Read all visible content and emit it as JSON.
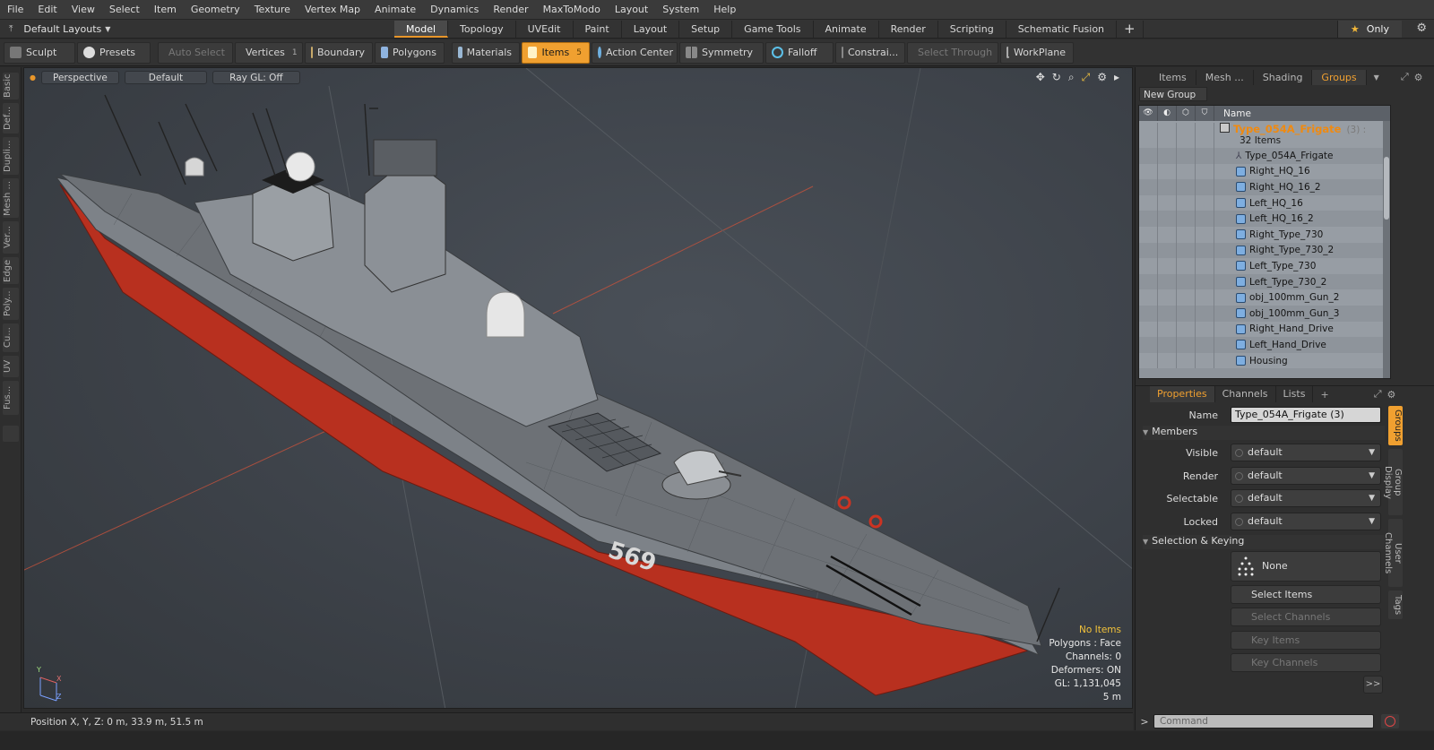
{
  "menu": [
    "File",
    "Edit",
    "View",
    "Select",
    "Item",
    "Geometry",
    "Texture",
    "Vertex Map",
    "Animate",
    "Dynamics",
    "Render",
    "MaxToModo",
    "Layout",
    "System",
    "Help"
  ],
  "layout": {
    "selector": "Default Layouts",
    "tabs": [
      "Model",
      "Topology",
      "UVEdit",
      "Paint",
      "Layout",
      "Setup",
      "Game Tools",
      "Animate",
      "Render",
      "Scripting",
      "Schematic Fusion"
    ],
    "active_tab": "Model",
    "only_label": "Only"
  },
  "toolbar": {
    "sculpt": "Sculpt",
    "presets": "Presets",
    "auto_select": "Auto Select",
    "vertices": "Vertices",
    "vertices_count": "1",
    "boundary": "Boundary",
    "polygons": "Polygons",
    "materials": "Materials",
    "items": "Items",
    "items_count": "5",
    "action_center": "Action Center",
    "symmetry": "Symmetry",
    "falloff": "Falloff",
    "constraints": "Constrai...",
    "select_through": "Select Through",
    "workplane": "WorkPlane"
  },
  "left_tabs": [
    "Basic",
    "Def...",
    "Dupli...",
    "Mesh ...",
    "Ver...",
    "Edge",
    "Poly...",
    "Cu...",
    "UV",
    "Fus..."
  ],
  "viewport": {
    "view": "Perspective",
    "shading": "Default",
    "raygl": "Ray GL: Off",
    "info": {
      "no_items": "No Items",
      "polygons": "Polygons : Face",
      "channels": "Channels: 0",
      "deformers": "Deformers: ON",
      "gl": "GL: 1,131,045",
      "scale": "5 m"
    },
    "hull_number": "569",
    "bow_number": "569"
  },
  "status": {
    "position": "Position X, Y, Z:   0 m, 33.9 m, 51.5 m"
  },
  "right_panel": {
    "tabs": [
      "Items",
      "Mesh ...",
      "Shading",
      "Groups"
    ],
    "active_tab": "Groups",
    "new_group": "New Group",
    "name_header": "Name",
    "group_name": "Type_054A_Frigate",
    "group_count": "(3) :",
    "group_items": "32 Items",
    "items": [
      "Type_054A_Frigate",
      "Right_HQ_16",
      "Right_HQ_16_2",
      "Left_HQ_16",
      "Left_HQ_16_2",
      "Right_Type_730",
      "Right_Type_730_2",
      "Left_Type_730",
      "Left_Type_730_2",
      "obj_100mm_Gun_2",
      "obj_100mm_Gun_3",
      "Right_Hand_Drive",
      "Left_Hand_Drive",
      "Housing"
    ],
    "prop_tabs": [
      "Properties",
      "Channels",
      "Lists"
    ],
    "prop_active": "Properties",
    "name_label": "Name",
    "name_value": "Type_054A_Frigate (3)",
    "members_label": "Members",
    "visible_label": "Visible",
    "render_label": "Render",
    "selectable_label": "Selectable",
    "locked_label": "Locked",
    "dropdown_default": "default",
    "selection_keying": "Selection & Keying",
    "none": "None",
    "select_items": "Select Items",
    "select_channels": "Select Channels",
    "key_items": "Key Items",
    "key_channels": "Key Channels",
    "more": ">>",
    "side_tabs": [
      "Groups",
      "Group Display",
      "User Channels",
      "Tags"
    ],
    "command_placeholder": "Command"
  },
  "colors": {
    "accent": "#f0a030",
    "hull_red": "#b8301f",
    "group_orange": "#f08a10"
  }
}
